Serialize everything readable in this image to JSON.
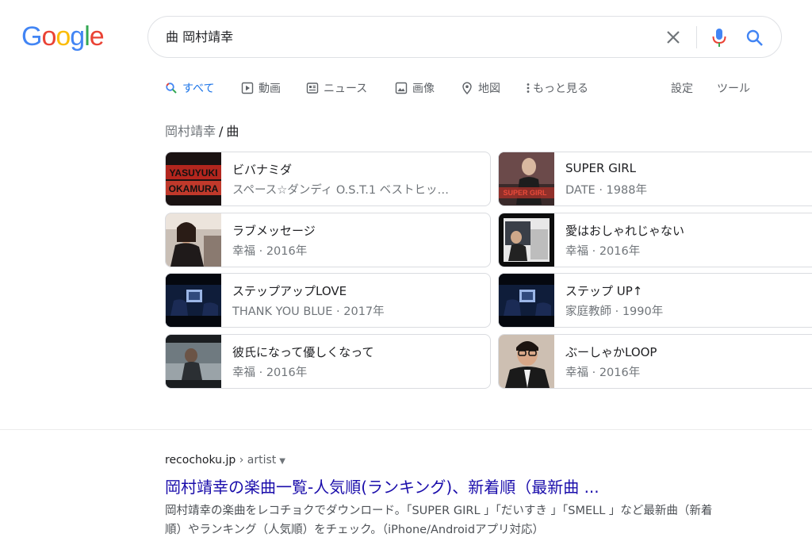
{
  "logo": {
    "l1": "G",
    "l2": "o",
    "l3": "o",
    "l4": "g",
    "l5": "l",
    "l6": "e"
  },
  "search": {
    "query": "曲 岡村靖幸"
  },
  "tabs": [
    {
      "label": "すべて",
      "icon": "search-icon",
      "active": true
    },
    {
      "label": "動画",
      "icon": "play-icon"
    },
    {
      "label": "ニュース",
      "icon": "newspaper-icon"
    },
    {
      "label": "画像",
      "icon": "image-icon"
    },
    {
      "label": "地図",
      "icon": "map-pin-icon"
    },
    {
      "label": "もっと見る",
      "icon": "more-vert-icon"
    },
    {
      "label": "設定"
    },
    {
      "label": "ツール"
    }
  ],
  "breadcrumb": {
    "artist": "岡村靖幸",
    "sep": "/",
    "current": "曲"
  },
  "songs": [
    {
      "title": "ビバナミダ",
      "sub": "スペース☆ダンディ O.S.T.1 ベストヒッ…"
    },
    {
      "title": "SUPER GIRL",
      "sub": "DATE · 1988年"
    },
    {
      "title": "ラブメッセージ",
      "sub": "幸福 · 2016年"
    },
    {
      "title": "愛はおしゃれじゃない",
      "sub": "幸福 · 2016年"
    },
    {
      "title": "ステップアップLOVE",
      "sub": "THANK YOU BLUE · 2017年"
    },
    {
      "title": "ステップ UP↑",
      "sub": "家庭教師 · 1990年"
    },
    {
      "title": "彼氏になって優しくなって",
      "sub": "幸福 · 2016年"
    },
    {
      "title": "ぶーしゃかLOOP",
      "sub": "幸福 · 2016年"
    }
  ],
  "thumb_text": {
    "yasuyuki": "YASUYUKI",
    "okamura": "OKAMURA",
    "supergirl": "SUPER GIRL"
  },
  "result": {
    "domain": "recochoku.jp",
    "path": " › artist",
    "title": "岡村靖幸の楽曲一覧-人気順(ランキング)、新着順（最新曲 ...",
    "snippet": "岡村靖幸の楽曲をレコチョクでダウンロード。「SUPER GIRL 」「だいすき 」「SMELL 」など最新曲（新着順）やランキング（人気順）をチェック。（iPhone/Androidアプリ対応）"
  },
  "colors": {
    "link": "#1a0dab",
    "accent": "#1a73e8",
    "border": "#dadce0"
  }
}
